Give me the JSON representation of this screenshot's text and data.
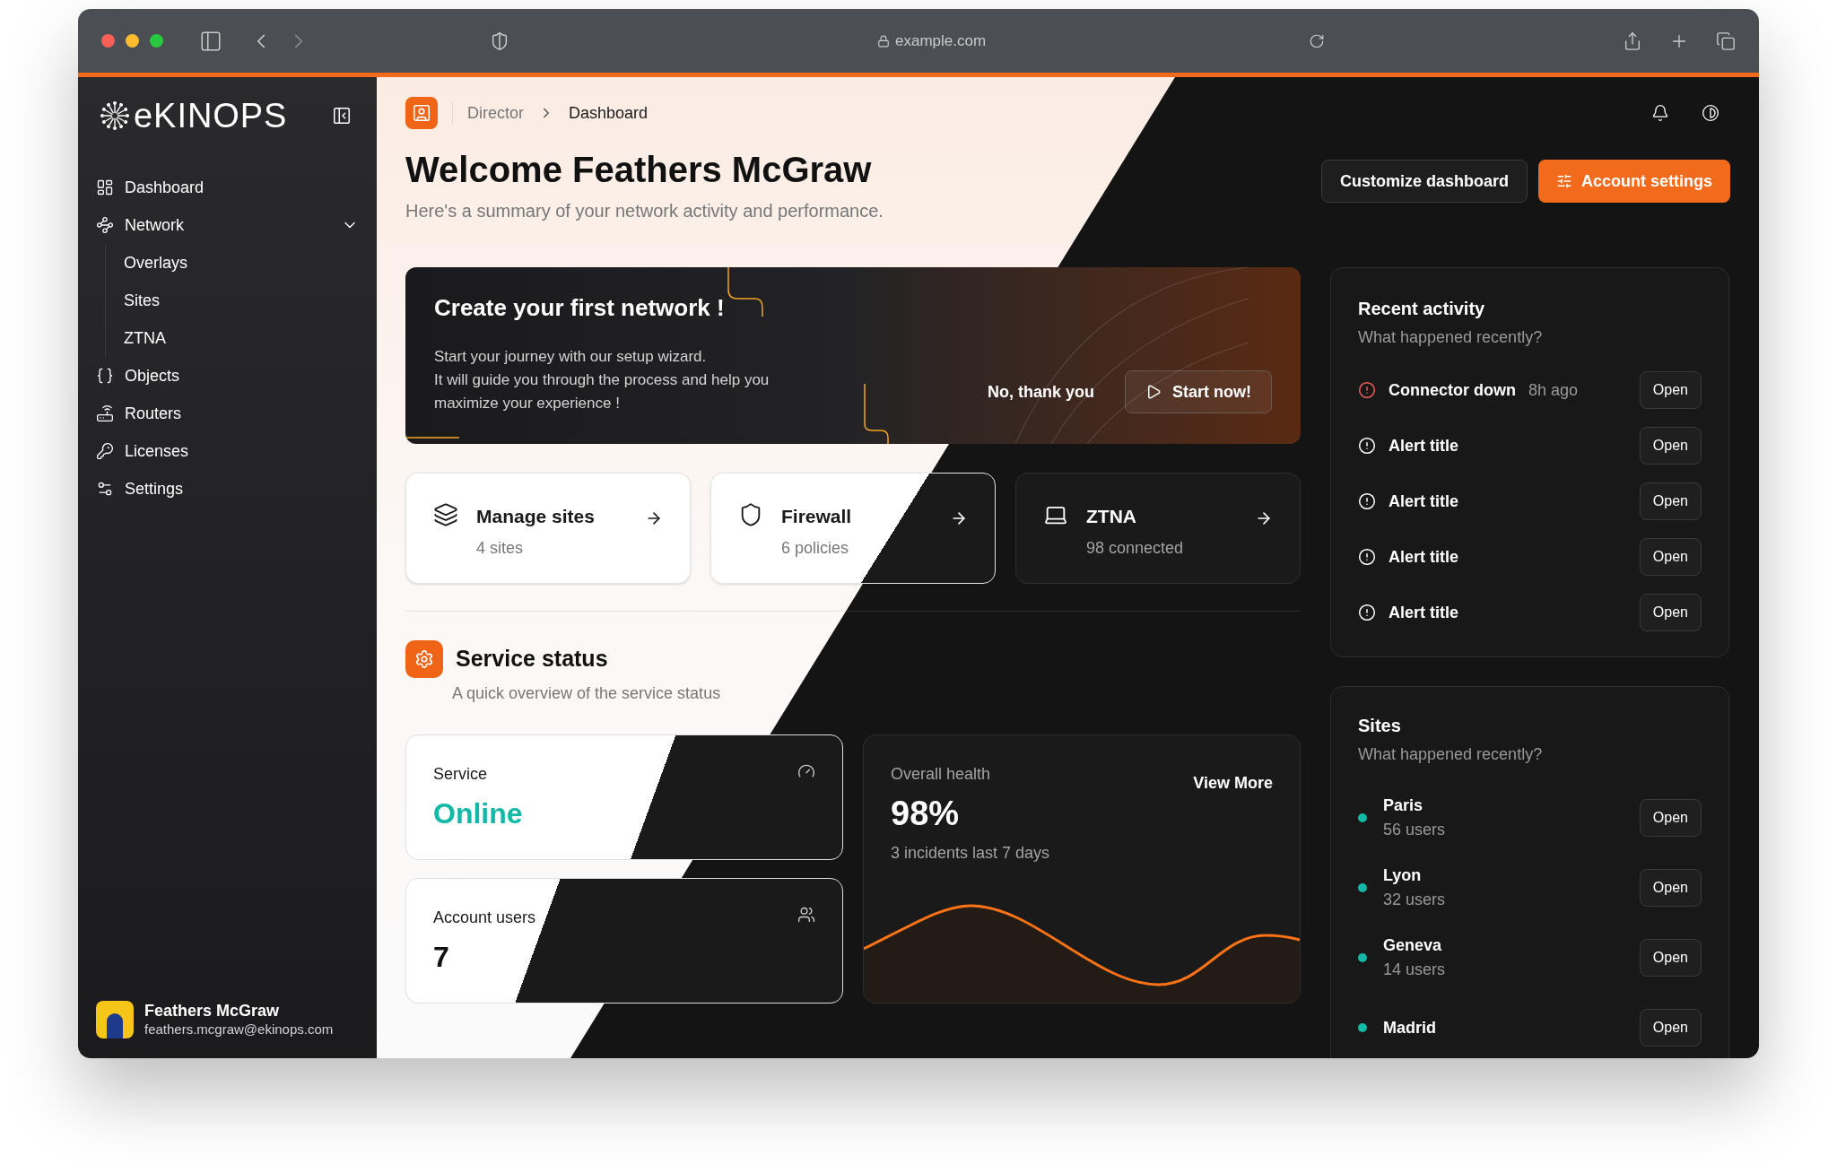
{
  "browser": {
    "url": "example.com"
  },
  "sidebar": {
    "logo": "eKINOPS",
    "nav": [
      {
        "label": "Dashboard"
      },
      {
        "label": "Network",
        "expanded": true,
        "children": [
          {
            "label": "Overlays"
          },
          {
            "label": "Sites"
          },
          {
            "label": "ZTNA"
          }
        ]
      },
      {
        "label": "Objects"
      },
      {
        "label": "Routers"
      },
      {
        "label": "Licenses"
      },
      {
        "label": "Settings"
      }
    ],
    "user": {
      "name": "Feathers McGraw",
      "email": "feathers.mcgraw@ekinops.com"
    }
  },
  "breadcrumb": [
    "Director",
    "Dashboard"
  ],
  "header": {
    "title": "Welcome Feathers McGraw",
    "subtitle": "Here's a summary of your network activity and performance.",
    "buttons": [
      {
        "label": "Customize dashboard",
        "kind": "secondary"
      },
      {
        "label": "Account settings",
        "kind": "primary"
      }
    ]
  },
  "hero": {
    "title": "Create your first network !",
    "body": "Start your journey with our setup wizard.\nIt will guide you through the process and help you\nmaximize your experience !",
    "dismiss": "No, thank you",
    "start": "Start now!"
  },
  "shortcuts": [
    {
      "title": "Manage sites",
      "subtitle": "4 sites"
    },
    {
      "title": "Firewall",
      "subtitle": "6 policies"
    },
    {
      "title": "ZTNA",
      "subtitle": "98 connected"
    }
  ],
  "service_status": {
    "title": "Service status",
    "subtitle": "A quick overview of the service status",
    "service": {
      "label": "Service",
      "value": "Online"
    },
    "users": {
      "label": "Account users",
      "value": "7"
    },
    "health": {
      "label": "Overall health",
      "value": "98%",
      "note": "3 incidents last 7 days",
      "link": "View More"
    }
  },
  "recent_activity": {
    "title": "Recent activity",
    "subtitle": "What happened recently?",
    "items": [
      {
        "title": "Connector down",
        "time": "8h ago",
        "kind": "error",
        "action": "Open"
      },
      {
        "title": "Alert title",
        "kind": "info",
        "action": "Open"
      },
      {
        "title": "Alert title",
        "kind": "info",
        "action": "Open"
      },
      {
        "title": "Alert title",
        "kind": "info",
        "action": "Open"
      },
      {
        "title": "Alert title",
        "kind": "info",
        "action": "Open"
      }
    ]
  },
  "sites": {
    "title": "Sites",
    "subtitle": "What happened recently?",
    "items": [
      {
        "name": "Paris",
        "users": "56 users",
        "color": "#14b8a6",
        "action": "Open"
      },
      {
        "name": "Lyon",
        "users": "32 users",
        "color": "#14b8a6",
        "action": "Open"
      },
      {
        "name": "Geneva",
        "users": "14 users",
        "color": "#14b8a6",
        "action": "Open"
      },
      {
        "name": "Madrid",
        "color": "#14b8a6",
        "action": "Open"
      }
    ]
  }
}
